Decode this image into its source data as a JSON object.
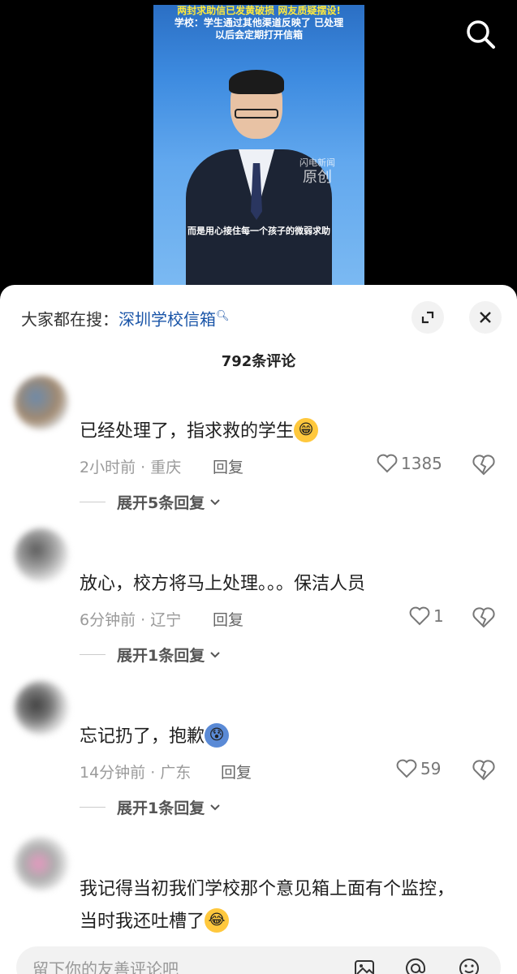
{
  "video": {
    "banner_line1": "两封求助信已发黄破损 网友质疑摆设!",
    "banner_line2": "学校：学生通过其他渠道反映了 已处理",
    "banner_line3": "以后会定期打开信箱",
    "watermark_small": "闪电新闻",
    "watermark_big": "原创",
    "subtitle": "而是用心接住每一个孩子的微弱求助"
  },
  "sheet": {
    "search_prefix": "大家都在搜：",
    "search_keyword": "深圳学校信箱",
    "comment_count": "792条评论"
  },
  "comments": [
    {
      "text": "已经处理了，指求救的学生",
      "emoji": "😁",
      "meta": "2小时前 · 重庆",
      "reply": "回复",
      "likes": "1385",
      "expand": "展开5条回复"
    },
    {
      "text": "放心，校方将马上处理。。。保洁人员",
      "emoji": "",
      "meta": "6分钟前 · 辽宁",
      "reply": "回复",
      "likes": "1",
      "expand": "展开1条回复"
    },
    {
      "text": "忘记扔了，抱歉",
      "emoji": "😰",
      "meta": "14分钟前 · 广东",
      "reply": "回复",
      "likes": "59",
      "expand": "展开1条回复"
    },
    {
      "text_line1": "我记得当初我们学校那个意见箱上面有个监控，",
      "text_line2": "当时我还吐槽了",
      "emoji": "😂"
    }
  ],
  "input": {
    "placeholder": "留下你的友善评论吧"
  }
}
